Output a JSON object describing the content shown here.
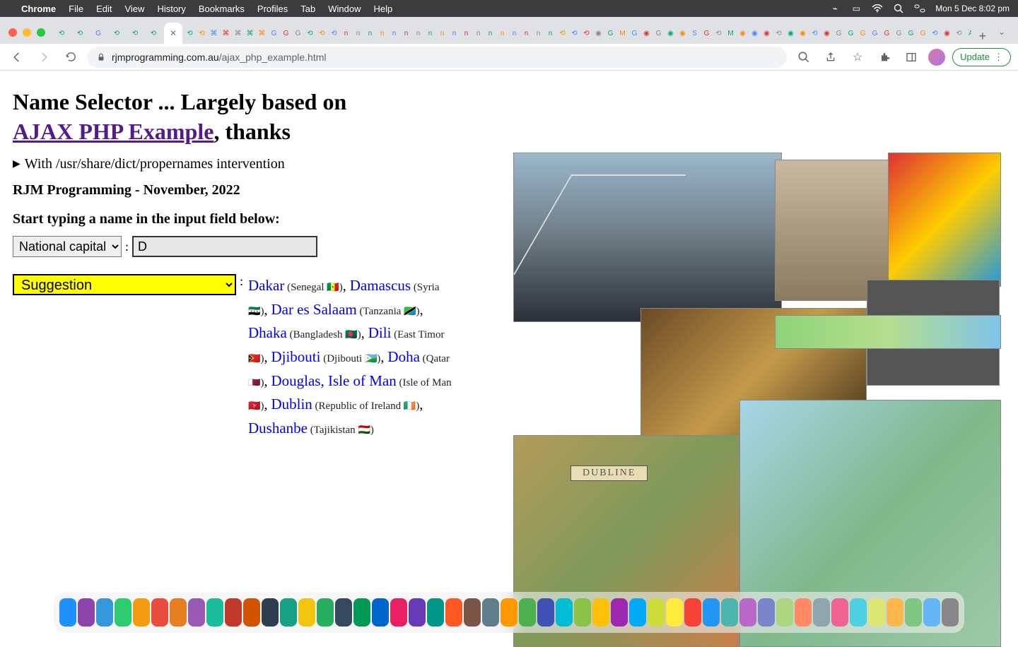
{
  "mac": {
    "app": "Chrome",
    "menus": [
      "File",
      "Edit",
      "View",
      "History",
      "Bookmarks",
      "Profiles",
      "Tab",
      "Window",
      "Help"
    ],
    "clock": "Mon 5 Dec  8:02 pm"
  },
  "browser": {
    "url_host": "rjmprogramming.com.au",
    "url_path": "/ajax_php_example.html",
    "update_label": "Update",
    "new_tab_plus": "+"
  },
  "page": {
    "title_prefix": "Name Selector ... Largely based on ",
    "title_link": "AJAX PHP Example",
    "title_suffix": ", thanks",
    "details_text": "With /usr/share/dict/propernames intervention",
    "byline": "RJM Programming - November, 2022",
    "prompt": "Start typing a name in the input field below:",
    "select_value": "National capital",
    "input_value": "D",
    "suggestion_label": "Suggestion",
    "dubline_label": "DUBLINE",
    "suggestions": [
      {
        "city": "Dakar",
        "country": "Senegal",
        "flag": "🇸🇳"
      },
      {
        "city": "Damascus",
        "country": "Syria",
        "flag": "🇸🇾"
      },
      {
        "city": "Dar es Salaam",
        "country": "Tanzania",
        "flag": "🇹🇿"
      },
      {
        "city": "Dhaka",
        "country": "Bangladesh",
        "flag": "🇧🇩"
      },
      {
        "city": "Dili",
        "country": "East Timor",
        "flag": "🇹🇱"
      },
      {
        "city": "Djibouti",
        "country": "Djibouti",
        "flag": "🇩🇯"
      },
      {
        "city": "Doha",
        "country": "Qatar",
        "flag": "🇶🇦"
      },
      {
        "city": "Douglas, Isle of Man",
        "country": "Isle of Man",
        "flag": "🇮🇲"
      },
      {
        "city": "Dublin",
        "country": "Republic of Ireland",
        "flag": "🇮🇪"
      },
      {
        "city": "Dushanbe",
        "country": "Tajikistan",
        "flag": "🇹🇯"
      }
    ]
  }
}
